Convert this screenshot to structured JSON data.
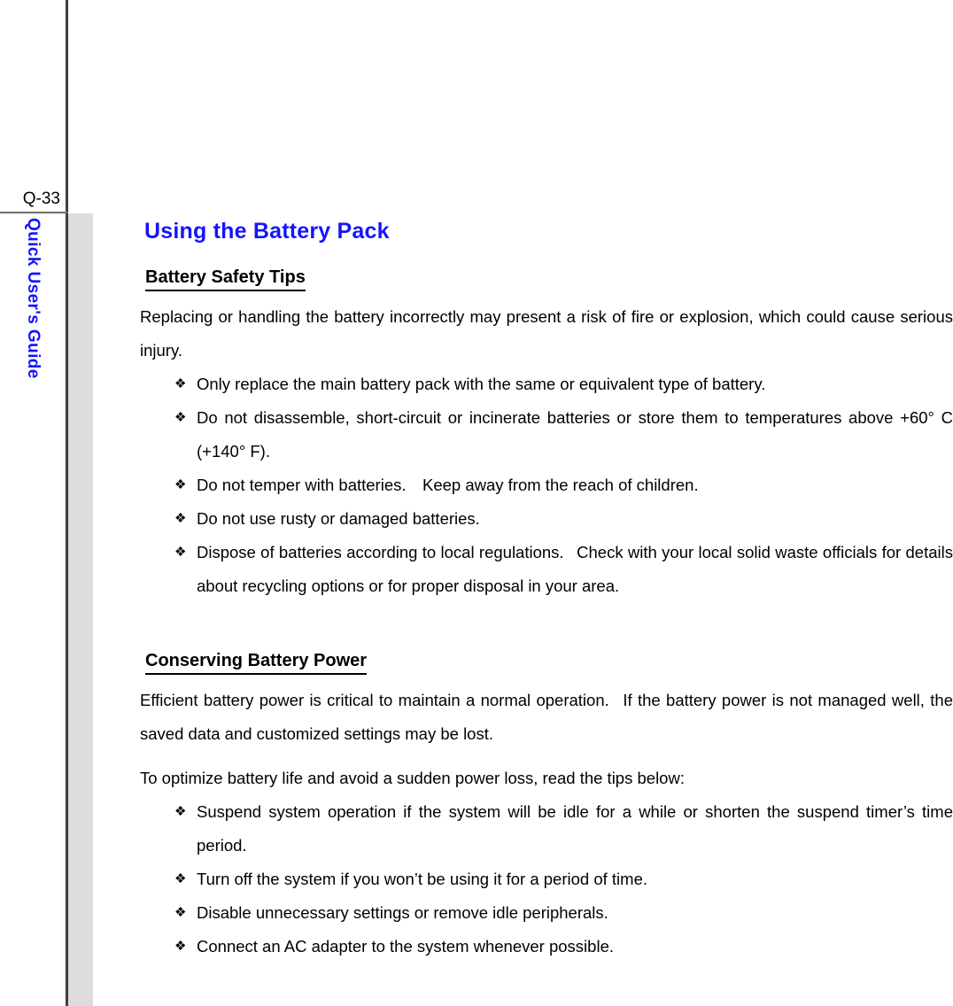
{
  "page": {
    "number_label": "Q-33",
    "side_title": "Quick User's Guide",
    "accent_color": "#1414ff",
    "band_color": "#dddddd",
    "rule_color": "#3f3f3f"
  },
  "document": {
    "title": "Using the Battery Pack",
    "sections": [
      {
        "heading": "Battery Safety Tips",
        "intro": "Replacing or handling the battery incorrectly may present a risk of fire or explosion, which could cause serious injury.",
        "bullet_symbol": "❖",
        "bullets": [
          "Only replace the main battery pack with the same or equivalent type of battery.",
          "Do not disassemble, short-circuit or incinerate batteries or store them to temperatures above +60° C (+140° F).",
          "Do not temper with batteries. Keep away from the reach of children.",
          "Do not use rusty or damaged batteries.",
          "Dispose of batteries according to local regulations.  Check with your local solid waste officials for details about recycling options or for proper disposal in your area."
        ]
      },
      {
        "heading": "Conserving Battery Power",
        "intro": "Efficient battery power is critical to maintain a normal operation.  If the battery power is not managed well, the saved data and customized settings may be lost.",
        "lead_in": "To optimize battery life and avoid a sudden power loss, read the tips below:",
        "bullet_symbol": "❖",
        "bullets": [
          "Suspend system operation if the system will be idle for a while or shorten the suspend timer’s time period.",
          "Turn off the system if you won’t be using it for a period of time.",
          "Disable unnecessary settings or remove idle peripherals.",
          "Connect an AC adapter to the system whenever possible."
        ]
      }
    ]
  }
}
